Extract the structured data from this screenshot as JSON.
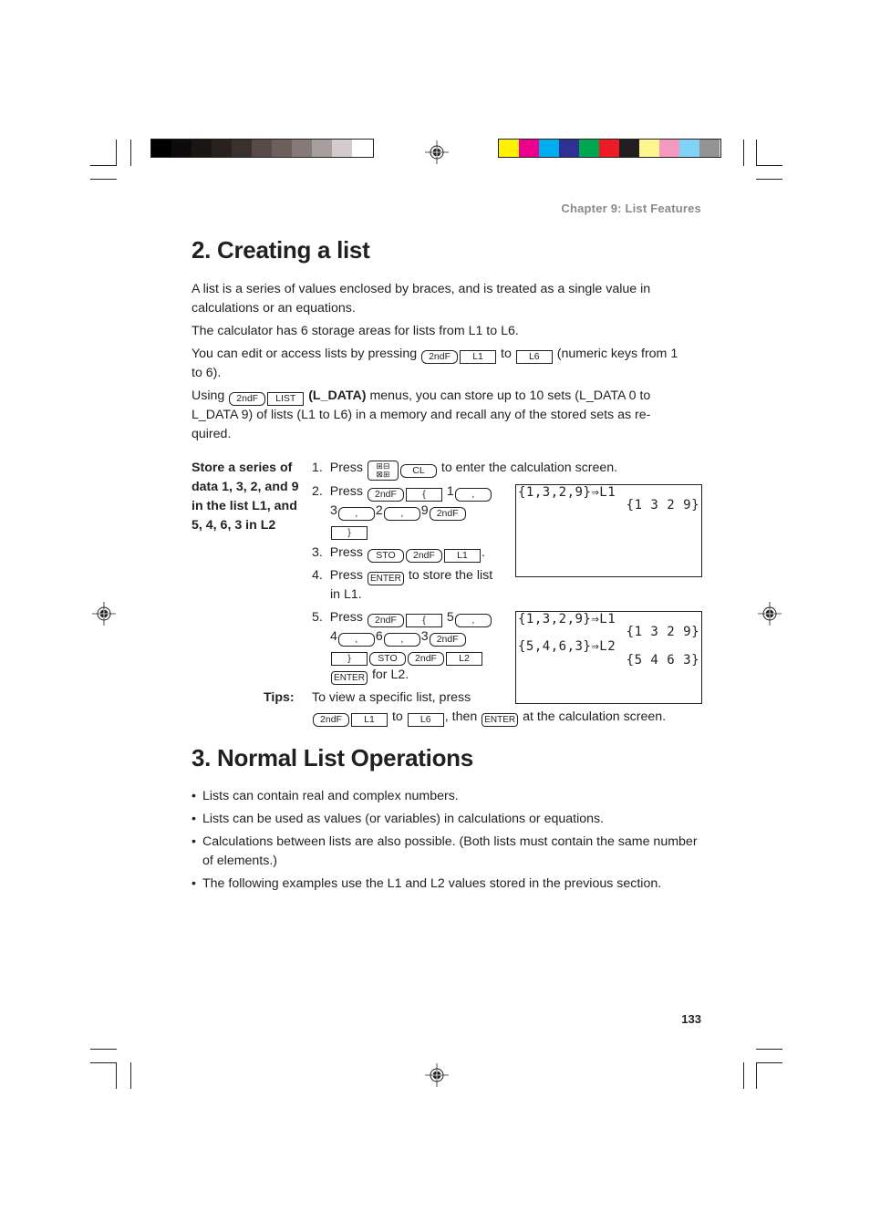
{
  "header": {
    "chapter": "Chapter 9: List Features"
  },
  "print_marks": {
    "gray_swatches": [
      "#000000",
      "#0d0b0a",
      "#1a1614",
      "#28211f",
      "#3a302d",
      "#564b48",
      "#6d605c",
      "#86797a",
      "#a89e9d",
      "#d4cbcc",
      "#ffffff"
    ],
    "color_swatches": [
      "#fff200",
      "#ec008c",
      "#00aeef",
      "#2e3192",
      "#00a651",
      "#ed1c24",
      "#231f20",
      "#fff68f",
      "#f49ac1",
      "#7fd3f7",
      "#939393"
    ]
  },
  "section2": {
    "title": "2. Creating a list",
    "para1": "A list is a series of values enclosed by braces, and is treated as a single value in calculations or an equations.",
    "para2": "The calculator has 6 storage areas for lists from L1 to L6.",
    "para3": {
      "before": "You can edit or access lists by pressing",
      "key1": "2ndF",
      "key2": "L1",
      "mid": "to",
      "key3": "L6",
      "after": "(numeric keys from 1",
      "line2": "to 6)."
    },
    "para4": {
      "before": "Using",
      "key1": "2ndF",
      "key2": "LIST",
      "bold": "(L_DATA)",
      "after": "menus, you can store up to 10 sets (L_DATA 0 to",
      "line2": "L_DATA 9) of lists (L1 to L6) in a memory and recall any of the stored sets as re-",
      "line3": "quired."
    },
    "example_heading": "Store a series of data 1, 3, 2, and 9 in the list L1, and 5, 4, 6, 3 in L2",
    "steps": {
      "s1": {
        "num": "1.",
        "press": "Press",
        "key_menu": "⊞⊟\n⊠⊞",
        "key_cl": "CL",
        "after": "to enter the calculation screen."
      },
      "s2": {
        "num": "2.",
        "press": "Press",
        "k_2ndf": "2ndF",
        "k_lbrace": "{",
        "n1": "1",
        "k_comma": ",",
        "n3": "3",
        "n2": "2",
        "n9": "9",
        "k_rbrace": "}"
      },
      "s3": {
        "num": "3.",
        "press": "Press",
        "k_sto": "STO",
        "k_2ndf": "2ndF",
        "k_l1": "L1",
        "after": "."
      },
      "s4": {
        "num": "4.",
        "press": "Press",
        "k_enter": "ENTER",
        "after": "to store the list",
        "line2": "in L1."
      },
      "s5": {
        "num": "5.",
        "press": "Press",
        "k_2ndf": "2ndF",
        "k_lbrace": "{",
        "n5": "5",
        "k_comma": ",",
        "n4": "4",
        "n6": "6",
        "n3": "3",
        "k_rbrace": "}",
        "k_sto": "STO",
        "k_l2": "L2",
        "k_enter": "ENTER",
        "after": "for L2."
      }
    },
    "screen1": {
      "line1": "{1,3,2,9}⇒L1",
      "line2": "{1 3 2 9}"
    },
    "screen2": {
      "line1": "{1,3,2,9}⇒L1",
      "line2": "{1 3 2 9}",
      "line3": "{5,4,6,3}⇒L2",
      "line4": "{5 4 6 3}"
    },
    "tips": {
      "label": "Tips:",
      "line1": "To view a specific list, press",
      "k_2ndf": "2ndF",
      "k_l1": "L1",
      "to": "to",
      "k_l6": "L6",
      "then": ", then",
      "k_enter": "ENTER",
      "after": "at the calculation screen."
    }
  },
  "section3": {
    "title": "3. Normal List Operations",
    "bullets": [
      "Lists can contain real and complex numbers.",
      "Lists can be used as values (or variables) in calculations or equations.",
      "Calculations between lists are also possible. (Both lists must contain the same number of elements.)",
      "The following examples use the L1 and L2 values stored in the previous section."
    ]
  },
  "footer": {
    "page_number": "133"
  }
}
